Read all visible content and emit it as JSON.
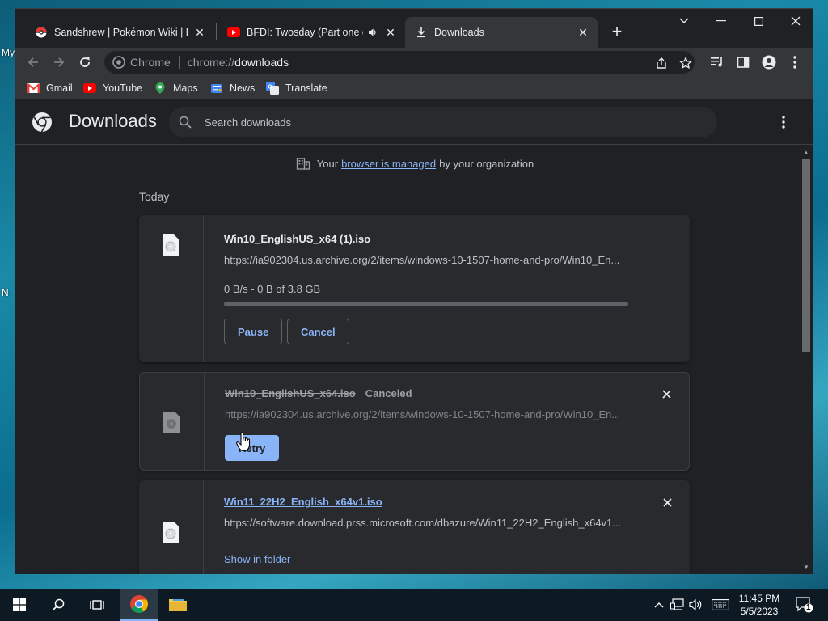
{
  "desktop": {
    "fragments": [
      "My",
      "N"
    ]
  },
  "tabs": [
    {
      "title": "Sandshrew | Pokémon Wiki | Fandom",
      "icon": "pokeball-icon",
      "active": false
    },
    {
      "title": "BFDI: Twosday (Part one of Two)",
      "icon": "youtube-icon",
      "active": false,
      "audio": true
    },
    {
      "title": "Downloads",
      "icon": "download-icon",
      "active": true
    }
  ],
  "omnibox": {
    "chip": "Chrome",
    "scheme": "chrome://",
    "host": "downloads"
  },
  "bookmarks": [
    {
      "label": "Gmail",
      "icon": "gmail-icon"
    },
    {
      "label": "YouTube",
      "icon": "youtube-icon"
    },
    {
      "label": "Maps",
      "icon": "maps-icon"
    },
    {
      "label": "News",
      "icon": "news-icon"
    },
    {
      "label": "Translate",
      "icon": "translate-icon"
    }
  ],
  "page": {
    "title": "Downloads",
    "search_placeholder": "Search downloads",
    "managed_prefix": "Your",
    "managed_link": "browser is managed",
    "managed_suffix": "by your organization",
    "section": "Today"
  },
  "downloads": [
    {
      "name": "Win10_EnglishUS_x64 (1).iso",
      "url": "https://ia902304.us.archive.org/2/items/windows-10-1507-home-and-pro/Win10_En...",
      "status": "0 B/s - 0 B of 3.8 GB",
      "progress": 0,
      "buttons": [
        "Pause",
        "Cancel"
      ]
    },
    {
      "name": "Win10_EnglishUS_x64.iso",
      "tag": "Canceled",
      "url": "https://ia902304.us.archive.org/2/items/windows-10-1507-home-and-pro/Win10_En...",
      "buttons": [
        "Retry"
      ]
    },
    {
      "name": "Win11_22H2_English_x64v1.iso",
      "url": "https://software.download.prss.microsoft.com/dbazure/Win11_22H2_English_x64v1...",
      "link": "Show in folder"
    }
  ],
  "taskbar": {
    "time": "11:45 PM",
    "date": "5/5/2023",
    "notifications": "1"
  },
  "colors": {
    "accent": "#8ab4f8",
    "background": "#202124",
    "card": "#292a2d"
  }
}
